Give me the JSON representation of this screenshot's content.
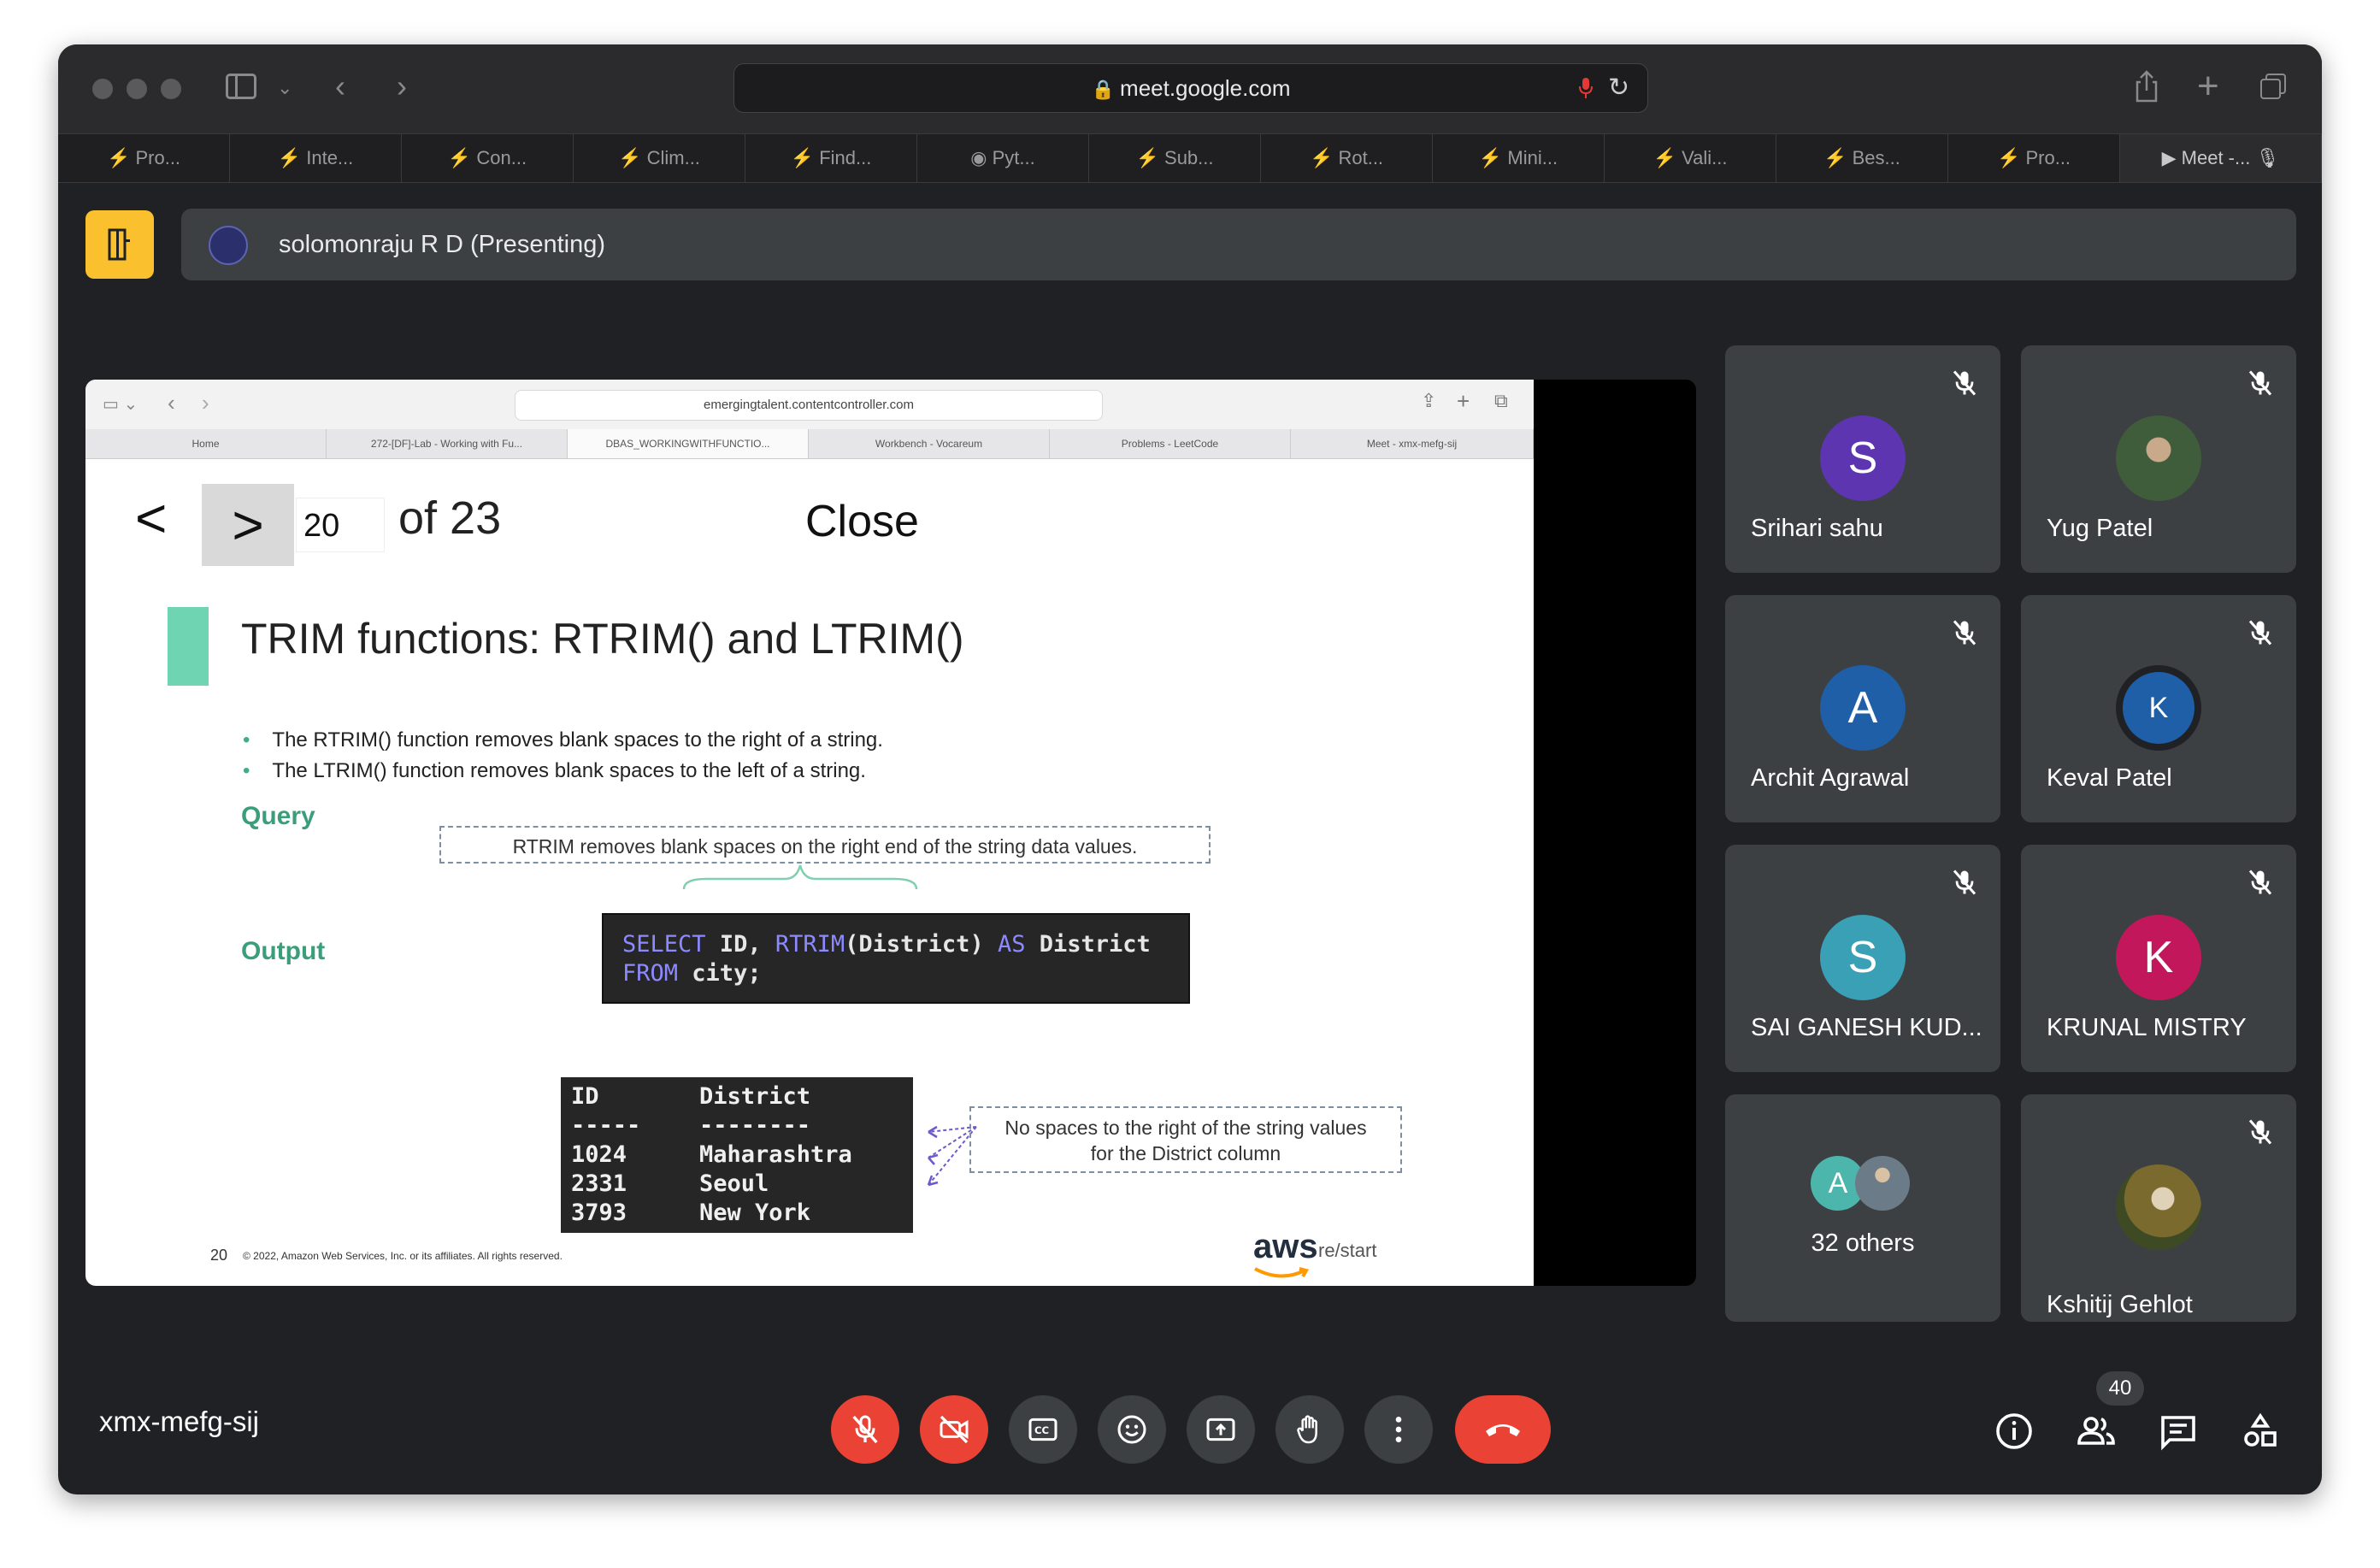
{
  "browser": {
    "url": "meet.google.com",
    "tabs": [
      "Pro...",
      "Inte...",
      "Con...",
      "Clim...",
      "Find...",
      "Pyt...",
      "Sub...",
      "Rot...",
      "Mini...",
      "Vali...",
      "Bes...",
      "Pro...",
      "Meet -..."
    ]
  },
  "presenting": {
    "label": "solomonraju R D (Presenting)"
  },
  "shared_screen": {
    "url": "emergingtalent.contentcontroller.com",
    "tabs": [
      "Home",
      "272-[DF]-Lab - Working with Fu...",
      "DBAS_WORKINGWITHFUNCTIO...",
      "Workbench - Vocareum",
      "Problems - LeetCode",
      "Meet - xmx-mefg-sij"
    ],
    "nav": {
      "prev": "<",
      "next": ">",
      "page": "20",
      "of_total": "of 23",
      "close": "Close"
    },
    "slide": {
      "title": "TRIM functions: RTRIM() and LTRIM()",
      "bullets": [
        "The RTRIM() function removes blank spaces to the right of a string.",
        "The LTRIM() function removes blank spaces to the left of a string."
      ],
      "query_label": "Query",
      "callout_query": "RTRIM removes blank spaces on the right end of the string data values.",
      "code": {
        "select": "SELECT",
        "id": "ID,",
        "rtrim": "RTRIM",
        "arg": "(District)",
        "as": "AS",
        "alias": "District",
        "from": "FROM",
        "table": "city;"
      },
      "output_label": "Output",
      "output_table": {
        "headers": [
          "ID",
          "District"
        ],
        "separators": [
          "-----",
          "--------"
        ],
        "rows": [
          [
            "1024",
            "Maharashtra"
          ],
          [
            "2331",
            "Seoul"
          ],
          [
            "3793",
            "New York"
          ]
        ]
      },
      "callout_output_line1": "No spaces to the right of the string values",
      "callout_output_line2": "for the District column",
      "page_number": "20",
      "copyright": "© 2022, Amazon Web Services, Inc. or its affiliates. All rights reserved.",
      "logo_main": "aws",
      "logo_sub": "re/start"
    }
  },
  "participants": [
    {
      "name": "Srihari sahu",
      "initial": "S",
      "color": "#5e35b1",
      "muted": true
    },
    {
      "name": "Yug Patel",
      "initial": "",
      "color": "#6d8f4e",
      "muted": true
    },
    {
      "name": "Archit Agrawal",
      "initial": "A",
      "color": "#1e5fa8",
      "muted": true
    },
    {
      "name": "Keval Patel",
      "initial": "K",
      "color": "#1e5fa8",
      "muted": true
    },
    {
      "name": "SAI GANESH KUD...",
      "initial": "S",
      "color": "#3aa0b5",
      "muted": true
    },
    {
      "name": "KRUNAL MISTRY",
      "initial": "K",
      "color": "#c2185b",
      "muted": true
    },
    {
      "name": "32 others",
      "initial": "A",
      "color": "#4db6ac",
      "muted": false
    },
    {
      "name": "Kshitij Gehlot",
      "initial": "",
      "color": "#8a6d3b",
      "muted": true
    }
  ],
  "meeting": {
    "code": "xmx-mefg-sij",
    "people_count": "40"
  },
  "colors": {
    "accent_red": "#ea4335",
    "leave_yellow": "#fbc02d",
    "slide_green": "#3a9e7a"
  }
}
